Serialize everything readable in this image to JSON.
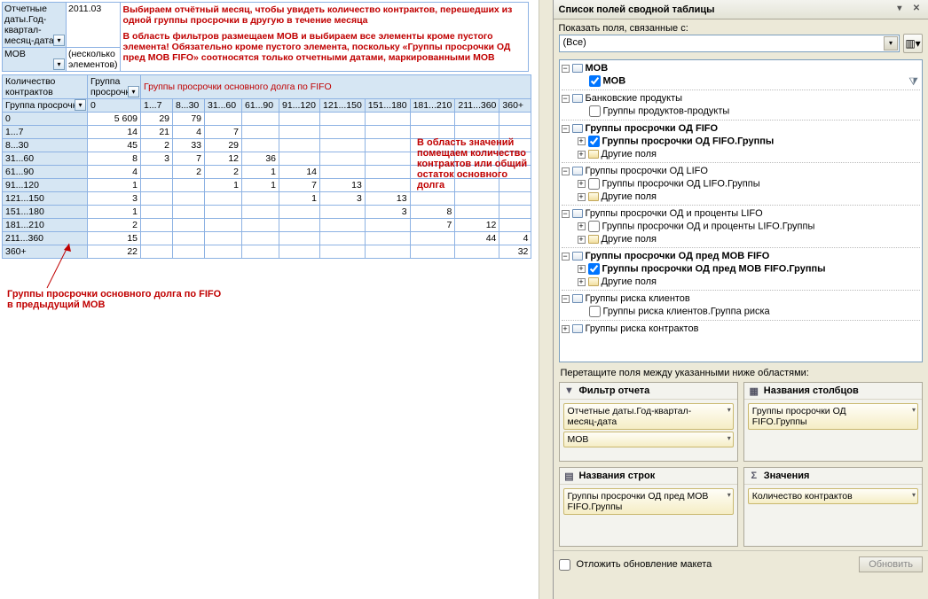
{
  "filters": {
    "date_label": "Отчетные даты.Год-квартал-месяц-дата",
    "date_value": "2011.03",
    "mob_label": "MOB",
    "mob_value": "(несколько элементов)"
  },
  "notes": {
    "top1": "Выбираем отчётный месяц, чтобы увидеть количество контрактов, перешедших из одной группы просрочки в другую в течение месяца",
    "top2": "В область фильтров размещаем MOB и выбираем все элементы кроме пустого элемента! Обязательно кроме пустого элемента, поскольку «Группы просрочки ОД пред MOB FIFO» соотносятся только отчетными датами, маркированными MOB",
    "values_area1": "В область значений",
    "values_area2": "помещаем количество",
    "values_area3": "контрактов или общий",
    "values_area4": "остаток основного",
    "values_area5": "долга",
    "bottom1": "Группы просрочки основного долга по FIFO",
    "bottom2": "в предыдущий MOB"
  },
  "pivot": {
    "measure_label": "Количество контрактов",
    "row_field_label": "Группа просрочки",
    "col_field_label": "Группа просрочки",
    "col_group_title": "Группы просрочки основного долга по FIFO",
    "columns": [
      "0",
      "1...7",
      "8...30",
      "31...60",
      "61...90",
      "91...120",
      "121...150",
      "151...180",
      "181...210",
      "211...360",
      "360+"
    ],
    "rows": [
      {
        "label": "0",
        "cells": [
          "5 609",
          "29",
          "79",
          "",
          "",
          "",
          "",
          "",
          "",
          "",
          ""
        ]
      },
      {
        "label": "1...7",
        "cells": [
          "14",
          "21",
          "4",
          "7",
          "",
          "",
          "",
          "",
          "",
          "",
          ""
        ]
      },
      {
        "label": "8...30",
        "cells": [
          "45",
          "2",
          "33",
          "29",
          "",
          "",
          "",
          "",
          "",
          "",
          ""
        ]
      },
      {
        "label": "31...60",
        "cells": [
          "8",
          "3",
          "7",
          "12",
          "36",
          "",
          "",
          "",
          "",
          "",
          ""
        ]
      },
      {
        "label": "61...90",
        "cells": [
          "4",
          "",
          "2",
          "2",
          "1",
          "14",
          "",
          "",
          "",
          "",
          ""
        ]
      },
      {
        "label": "91...120",
        "cells": [
          "1",
          "",
          "",
          "1",
          "1",
          "7",
          "13",
          "",
          "",
          "",
          ""
        ]
      },
      {
        "label": "121...150",
        "cells": [
          "3",
          "",
          "",
          "",
          "",
          "1",
          "3",
          "13",
          "",
          "",
          ""
        ]
      },
      {
        "label": "151...180",
        "cells": [
          "1",
          "",
          "",
          "",
          "",
          "",
          "",
          "3",
          "8",
          "",
          ""
        ]
      },
      {
        "label": "181...210",
        "cells": [
          "2",
          "",
          "",
          "",
          "",
          "",
          "",
          "",
          "7",
          "12",
          ""
        ]
      },
      {
        "label": "211...360",
        "cells": [
          "15",
          "",
          "",
          "",
          "",
          "",
          "",
          "",
          "",
          "44",
          "4"
        ]
      },
      {
        "label": "360+",
        "cells": [
          "22",
          "",
          "",
          "",
          "",
          "",
          "",
          "",
          "",
          "",
          "32"
        ]
      }
    ]
  },
  "fieldlist": {
    "title": "Список полей сводной таблицы",
    "show_fields_label": "Показать поля, связанные с:",
    "related_value": "(Все)",
    "groups": [
      {
        "type": "table",
        "expand": "-",
        "label": "MOB",
        "bold": true,
        "children": [
          {
            "check": true,
            "label": "MOB",
            "bold": true,
            "filtered": true
          }
        ]
      },
      {
        "type": "table",
        "expand": "-",
        "label": "Банковские продукты",
        "children": [
          {
            "check": false,
            "label": "Группы продуктов-продукты"
          }
        ]
      },
      {
        "type": "table",
        "expand": "-",
        "label": "Группы просрочки ОД FIFO",
        "bold": true,
        "children": [
          {
            "expand": "+",
            "check": true,
            "label": "Группы просрочки ОД FIFO.Группы",
            "bold": true
          },
          {
            "expand": "+",
            "label": "Другие поля",
            "fld": true
          }
        ]
      },
      {
        "type": "table",
        "expand": "-",
        "label": "Группы просрочки ОД LIFO",
        "children": [
          {
            "expand": "+",
            "check": false,
            "label": "Группы просрочки ОД LIFO.Группы"
          },
          {
            "expand": "+",
            "label": "Другие поля",
            "fld": true
          }
        ]
      },
      {
        "type": "table",
        "expand": "-",
        "label": "Группы просрочки ОД и проценты LIFO",
        "children": [
          {
            "expand": "+",
            "check": false,
            "label": "Группы просрочки ОД и проценты LIFO.Группы"
          },
          {
            "expand": "+",
            "label": "Другие поля",
            "fld": true
          }
        ]
      },
      {
        "type": "table",
        "expand": "-",
        "label": "Группы просрочки ОД пред MOB FIFO",
        "bold": true,
        "children": [
          {
            "expand": "+",
            "check": true,
            "label": "Группы просрочки ОД пред MOB FIFO.Группы",
            "bold": true
          },
          {
            "expand": "+",
            "label": "Другие поля",
            "fld": true
          }
        ]
      },
      {
        "type": "table",
        "expand": "-",
        "label": "Группы риска клиентов",
        "children": [
          {
            "check": false,
            "label": "Группы риска клиентов.Группа риска"
          }
        ]
      },
      {
        "type": "table",
        "expand": "+",
        "label": "Группы риска контрактов"
      }
    ],
    "drag_instruction": "Перетащите поля между указанными ниже областями:",
    "zones": {
      "report_filter": {
        "label": "Фильтр отчета",
        "items": [
          "Отчетные даты.Год-квартал-месяц-дата",
          "MOB"
        ]
      },
      "column_labels": {
        "label": "Названия столбцов",
        "items": [
          "Группы просрочки ОД FIFO.Группы"
        ]
      },
      "row_labels": {
        "label": "Названия строк",
        "items": [
          "Группы просрочки ОД пред MOB FIFO.Группы"
        ]
      },
      "values": {
        "label": "Значения",
        "items": [
          "Количество контрактов"
        ]
      }
    },
    "defer_label": "Отложить обновление макета",
    "update_btn": "Обновить"
  }
}
